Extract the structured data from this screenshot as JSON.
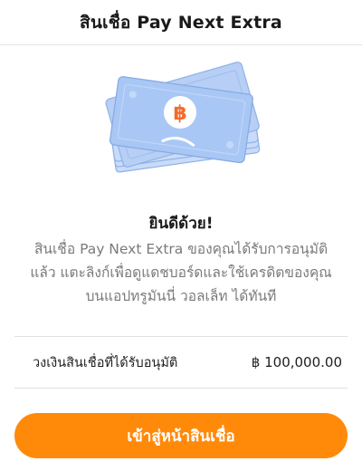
{
  "header": {
    "title": "สินเชื่อ Pay Next Extra"
  },
  "illustration": {
    "icon": "money-stack-icon",
    "currency_symbol": "฿"
  },
  "content": {
    "headline": "ยินดีด้วย!",
    "message": "สินเชื่อ Pay Next Extra ของคุณได้รับการอนุมัติแล้ว แตะลิงก์เพื่อดูแดชบอร์ดและใช้เครดิตของคุณบนแอปทรูมันนี่ วอลเล็ท ได้ทันที"
  },
  "approved_limit": {
    "label": "วงเงินสินเชื่อที่ได้รับอนุมัติ",
    "amount": "฿ 100,000.00"
  },
  "cta": {
    "label": "เข้าสู่หน้าสินเชื่อ"
  },
  "colors": {
    "accent": "#ff8a0a",
    "bill": "#a9c7f5",
    "coin": "#f26b2b"
  }
}
